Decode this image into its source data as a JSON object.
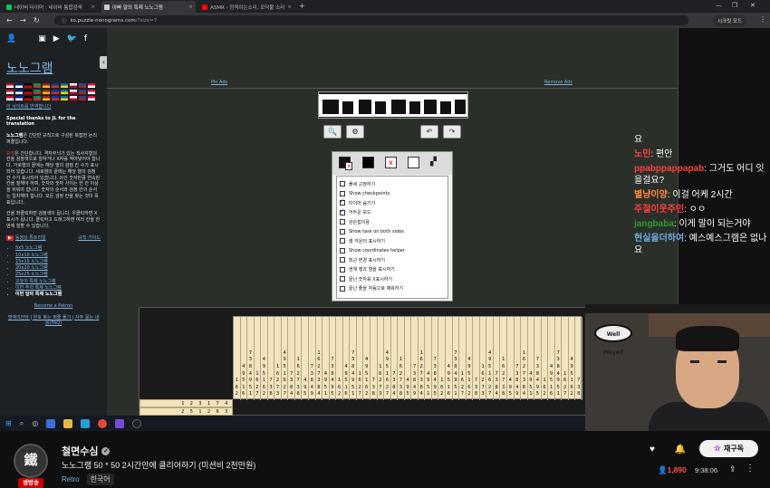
{
  "browser": {
    "tabs": [
      {
        "title": "네이버 타이머 : 네이버 통합검색",
        "favicon_color": "#03c75a",
        "active": false
      },
      {
        "title": "아빠 말의 특제 노노그램",
        "favicon_color": "#cccccc",
        "active": true
      },
      {
        "title": "ASMR - 정적이는소리, 모닥불 소리",
        "favicon_color": "#ff0000",
        "active": false
      }
    ],
    "new_tab": "+",
    "url": "ko.puzzle-nonograms.com",
    "url_path": "/?size=7",
    "profile": "시크릿 모드"
  },
  "sidebar": {
    "site_title": "노노그램",
    "translate_link": "이 사이트를 번역합니다",
    "thanks": "Special thanks to JL for the translation",
    "intro_bold": "노노그램",
    "intro": "은 간단한 규칙으로 구성된 복잡한 논리 퍼즐입니다.",
    "rules_label": "규칙",
    "rules": "은 간단합니다. 격자무늬가 있는 직사각형의 칸을 검정색으로 칠하거나 X자를 적어넣어야 합니다. 가로행의 끝에는 해당 행의 검정 칸 수가 표시되어 있습니다. 세로열의 끝에는 해당 열의 검정 칸 수가 표시되어 있습니다. 쓰인 숫자만큼 연속된 칸을 칠해야 하며, 숫자와 숫자 사이는 한 칸 이상을 비워야 합니다. 숫자의 순서와 검정 칸의 순서는 일치해야 합니다. 모든 검정 칸을 찾는 것이 목표입니다.",
    "controls": "칸을 좌클릭하면 검정색이 됩니다. 우클릭하면 X표시가 됩니다. 클릭하고 드래그하면 여러 칸을 한번에 칠할 수 있습니다.",
    "tutorial": "동영상 튜토리얼",
    "rules_link": "규칙 가이드",
    "sizes": [
      "5x5 노노그램",
      "10x10 노노그램",
      "15x15 노노그램",
      "20x20 노노그램",
      "25x25 노노그램",
      "오늘의 특제 노노그램",
      "이번 주의 특제 노노그램",
      "이번 달의 특제 노노그램"
    ],
    "patron": "Become a Patron",
    "footer": "명예의전당 | 번호 찾는 퍼즐 풀기 | 자주 묻는 내용(FAQ)"
  },
  "main": {
    "ad_left": "Pin Ads",
    "ad_right": "Remove Ads",
    "tools": [
      "zoom-icon",
      "gear-icon",
      "undo-icon",
      "redo-icon"
    ],
    "options": [
      {
        "label": "풀세 고정하기",
        "checked": false
      },
      {
        "label": "Show checkpoints",
        "checked": false
      },
      {
        "label": "타이머 숨기기",
        "checked": true
      },
      {
        "label": "어두운 모드",
        "checked": true
      },
      {
        "label": "완손잡이용",
        "checked": false
      },
      {
        "label": "Show task on both sides",
        "checked": false
      },
      {
        "label": "셀 카운터 표시하기",
        "checked": false
      },
      {
        "label": "Show coordinates helper",
        "checked": false
      },
      {
        "label": "최근 변경 표시하기",
        "checked": false
      },
      {
        "label": "현재 행과 열을 표시하기",
        "checked": false
      },
      {
        "label": "끝난 숫자를 X표시하기",
        "checked": false
      },
      {
        "label": "끝난 줄을 자동으로 채워하기",
        "checked": false
      }
    ],
    "row_clues": [
      "1 2 3 1 7 4",
      "2 5 1 2 6 3"
    ]
  },
  "chat": [
    {
      "user": "",
      "text": "요",
      "color": "#ffffff"
    },
    {
      "user": "노민",
      "text": "편안",
      "color": "#ff4040"
    },
    {
      "user": "ppabppappapab",
      "text": "그거도 어디 잇을걸요?",
      "color": "#ff4040"
    },
    {
      "user": "별냥이양",
      "text": "이걸 어케 2시간",
      "color": "#ff8a3d"
    },
    {
      "user": "주절이웃주민",
      "text": "ㅇㅇ",
      "color": "#ff4040"
    },
    {
      "user": "jangbaba",
      "text": "이게 말이 되는거야",
      "color": "#2e9b2e"
    },
    {
      "user": "현실을더하여",
      "text": "예스예스그램은 없나요",
      "color": "#6fa8dc"
    }
  ],
  "webcam": {
    "sign": "Well Played"
  },
  "youtube": {
    "channel": "철면수심",
    "avatar_text": "鐵",
    "live_badge": "생방송",
    "title": "노노그램 50 * 50 2시간안에 클리어하기 (미션비 2천만원)",
    "category": "Retro",
    "language": "한국어",
    "subscribe": "재구독",
    "viewers": "1,890",
    "elapsed": "9:38:06"
  }
}
